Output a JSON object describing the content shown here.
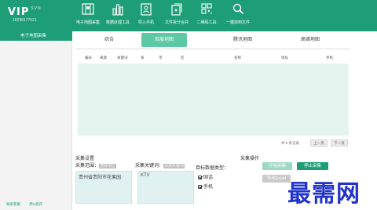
{
  "brand": {
    "logo_text": "VIP",
    "logo_suffix": "SVN",
    "phone": "18298177521"
  },
  "nav": [
    {
      "label": "电子地图采集",
      "icon": "map-icon"
    },
    {
      "label": "数据处理工具",
      "icon": "chart-icon"
    },
    {
      "label": "导入手机",
      "icon": "contacts-icon"
    },
    {
      "label": "文件拆分合并",
      "icon": "file-merge-icon"
    },
    {
      "label": "二维码工具",
      "icon": "qrcode-icon"
    },
    {
      "label": "一键找到文件",
      "icon": "search-icon"
    }
  ],
  "sidebar": {
    "active_item": "电子地图采集",
    "footer": [
      "联系客服",
      "用U盘开"
    ]
  },
  "tabs": [
    "综合",
    "百度地图",
    "腾讯地图",
    "高德地图"
  ],
  "active_tab": "百度地图",
  "table": {
    "columns": [
      "编号",
      "来源",
      "关键词",
      "省",
      "市",
      "区",
      "名称",
      "地址",
      "手机"
    ]
  },
  "pager": {
    "count_text": "共 0 条记录",
    "prev": "上一页",
    "next": "下一页"
  },
  "settings": {
    "title": "采集设置",
    "range_label": "采集范围：",
    "range_tag": "选择地区",
    "range_value": "贵州省贵阳市花果园",
    "keyword_label": "采集关键词：",
    "keyword_tag": "添加关键词",
    "keyword_value": "KTV",
    "type_label": "目标数据类型：",
    "types": [
      "固话",
      "手机"
    ]
  },
  "operations": {
    "title": "采集操作",
    "start": "开始采集",
    "stop": "停止采集",
    "export": "导出Excel"
  },
  "watermark": "最需网",
  "colors": {
    "primary": "#1e9e78",
    "tab_active": "#5cc9a4",
    "table_bg": "#e6f4ef"
  }
}
